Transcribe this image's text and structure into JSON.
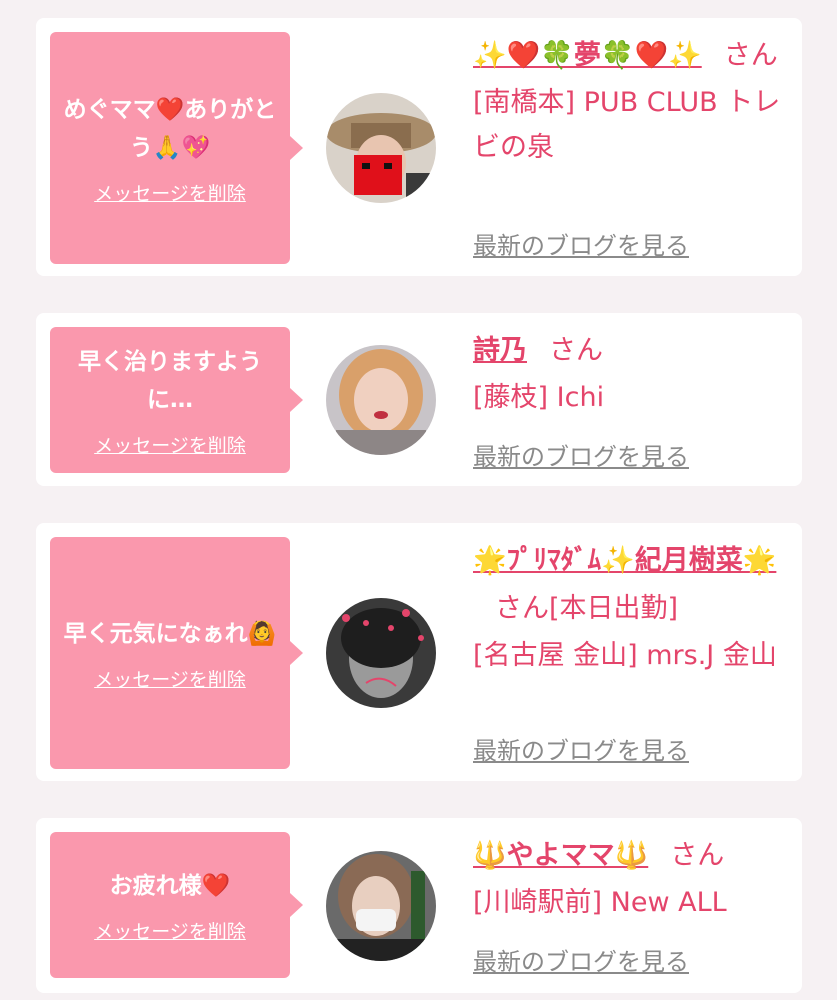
{
  "delete_label": "メッセージを削除",
  "blog_label": "最新のブログを見る",
  "san": "さん",
  "colors": {
    "bubble": "#fa98ad",
    "accent": "#e4456b",
    "link_gray": "#8a8a8a"
  },
  "cards": [
    {
      "message": "めぐママ❤️ありがとう🙏💖",
      "name": "✨❤️🍀夢🍀❤️✨",
      "suffix": "",
      "shop": "[南橋本] PUB CLUB トレビの泉"
    },
    {
      "message": "早く治りますように…",
      "name": "詩乃",
      "suffix": "",
      "shop": "[藤枝] Ichi"
    },
    {
      "message": "早く元気になぁれ🙆",
      "name": "🌟ﾌﾟﾘﾏﾀﾞﾑ✨紀月樹菜🌟",
      "suffix": "[本日出勤]",
      "shop": "[名古屋 金山] mrs.J 金山"
    },
    {
      "message": "お疲れ様❤️",
      "name": "🔱やよママ🔱",
      "suffix": "",
      "shop": "[川崎駅前] New ALL"
    }
  ]
}
